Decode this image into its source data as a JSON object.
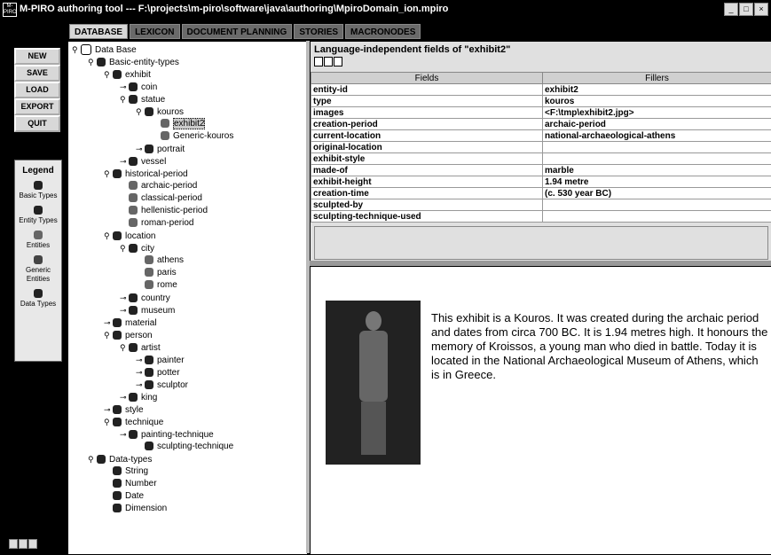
{
  "window": {
    "title": "M-PIRO authoring tool --- F:\\projects\\m-piro\\software\\java\\authoring\\MpiroDomain_ion.mpiro",
    "app_icon_text": "M-PIRO",
    "minimize": "_",
    "maximize": "□",
    "close": "×"
  },
  "tabs": [
    "DATABASE",
    "LEXICON",
    "DOCUMENT PLANNING",
    "STORIES",
    "MACRONODES"
  ],
  "buttons": [
    "NEW",
    "SAVE",
    "LOAD",
    "EXPORT",
    "QUIT"
  ],
  "legend": {
    "title": "Legend",
    "items": [
      "Basic Types",
      "Entity Types",
      "Entities",
      "Generic Entities",
      "Data Types"
    ]
  },
  "tree": [
    "Data Base",
    "Basic-entity-types",
    "exhibit",
    "coin",
    "statue",
    "kouros",
    "exhibit2",
    "Generic-kouros",
    "portrait",
    "vessel",
    "historical-period",
    "archaic-period",
    "classical-period",
    "hellenistic-period",
    "roman-period",
    "location",
    "city",
    "athens",
    "paris",
    "rome",
    "country",
    "museum",
    "material",
    "person",
    "artist",
    "painter",
    "potter",
    "sculptor",
    "king",
    "style",
    "technique",
    "painting-technique",
    "sculpting-technique",
    "Data-types",
    "String",
    "Number",
    "Date",
    "Dimension"
  ],
  "fields_panel": {
    "title": "Language-independent fields of \"exhibit2\"",
    "header": [
      "Fields",
      "Fillers"
    ],
    "rows": [
      [
        "entity-id",
        "exhibit2"
      ],
      [
        "type",
        "kouros"
      ],
      [
        "images",
        "<F:\\tmp\\exhibit2.jpg>"
      ],
      [
        "creation-period",
        "archaic-period"
      ],
      [
        "current-location",
        "national-archaeological-athens"
      ],
      [
        "original-location",
        ""
      ],
      [
        "exhibit-style",
        ""
      ],
      [
        "made-of",
        "marble"
      ],
      [
        "exhibit-height",
        "1.94 metre"
      ],
      [
        "creation-time",
        "(c. 530 year BC)"
      ],
      [
        "sculpted-by",
        ""
      ],
      [
        "sculpting-technique-used",
        ""
      ]
    ]
  },
  "preview": {
    "text": "This exhibit is a Kouros. It was created during the archaic period and dates from circa 700 BC. It is 1.94 metres high. It honours the memory of Kroissos, a young man who died in battle. Today it is located in the National Archaeological Museum of Athens, which is in Greece."
  }
}
